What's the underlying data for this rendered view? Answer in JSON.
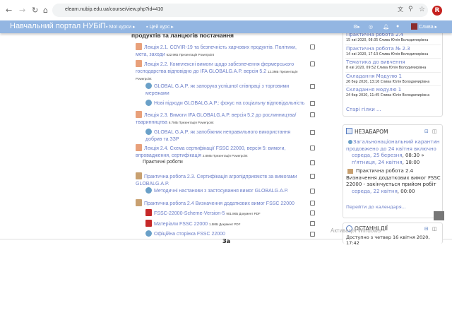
{
  "browser": {
    "url": "elearn.nubip.edu.ua/course/view.php?id=410",
    "profile_initial": "R"
  },
  "navbar": {
    "brand": "Навчальний портал НУБіП",
    "my_courses": "Мої курси ▸",
    "this_course": "Цей курс ▸",
    "user": "Слива ▸"
  },
  "main": {
    "section_title": "продуктів та ланцюгів постачання",
    "activities": [
      {
        "type": "ppt",
        "title": "Лекція 2.1. COVIR-19 та безпечність харчових продуктів. Політики, мета, заходи",
        "meta": "622.9КБ Презентація Powerpoint"
      },
      {
        "type": "ppt",
        "title": "Лекція 2.2. Комплексні вимоги щодо забезпечення фермерського господарства відповідно до IFA GLOBALG.A.P. версія 5.2",
        "meta": "12.3МБ Презентація Powerpoint"
      },
      {
        "type": "url",
        "title": "GLOBAL G.A.P. як запорука успішної співпраці з торговими мережами",
        "meta": ""
      },
      {
        "type": "url",
        "title": "Нові підходи GLOBALG.A.P.: фокус на соціальну відповідальність",
        "meta": ""
      },
      {
        "type": "ppt",
        "title": "Лекція 2.3. Вимоги IFA GLOBALG.A.P. версія 5.2 до рослинництва/тваринництва",
        "meta": "8.7МБ Презентація Powerpoint"
      },
      {
        "type": "url",
        "title": "GLOBAL G.A.P. як запобіжник неправильного використання добрив та ЗЗР",
        "meta": ""
      },
      {
        "type": "ppt",
        "title": "Лекція 2.4. Схема сертифікації FSSC 22000, версія 5: вимоги, впровадження, сертифікація",
        "meta": "2.8МБ Презентація Powerpoint"
      },
      {
        "type": "label",
        "title": "Практичні роботи",
        "meta": ""
      },
      {
        "type": "asg",
        "title": "Практична робота 2.3. Сертифікація агропідприємств за вимогами GLOBALG.A.P.",
        "meta": ""
      },
      {
        "type": "url",
        "title": "Методичні настанови з застосування вимог GLOBALG.A.P.",
        "meta": ""
      },
      {
        "type": "asg",
        "title": "Практична робота 2.4 Визначення додаткових вимог FSSC 22000",
        "meta": ""
      },
      {
        "type": "pdf",
        "title": "FSSC-22000-Scheme-Version-5",
        "meta": "901.8КБ Документ PDF"
      },
      {
        "type": "pdf",
        "title": "Матеріали FSSC 22000",
        "meta": "1.5МБ Документ PDF"
      },
      {
        "type": "url",
        "title": "Офіційна сторінка FSSC 22000",
        "meta": ""
      }
    ],
    "below_text": "За"
  },
  "forum": {
    "posts": [
      {
        "title": "Практична робота 2.4",
        "meta": "15 кві 2020, 08:35  Слива Юлія Володимирівна"
      },
      {
        "title": "Практична робота № 2.3",
        "meta": "14 кві 2020, 17:13  Слива Юлія Володимирівна"
      },
      {
        "title": "Тематика до вивчення",
        "meta": "8 кві 2020, 09:52  Слива Юлія Володимирівна"
      },
      {
        "title": "Складання Модулю 1",
        "meta": "26 бер 2020, 13:16  Слива Юлія Володимирівна"
      },
      {
        "title": "Складання модулю 1",
        "meta": "24 бер 2020, 11:45  Слива Юлія Володимирівна"
      }
    ],
    "older": "Старі гілки ..."
  },
  "upcoming": {
    "title": "НЕЗАБАРОМ",
    "e1_title": "Загальнонаціональний карантин продовжено до 24 квітня включно",
    "e1_date1": "середа, 25 березня",
    "e1_time1": ", 08:30 »",
    "e1_date2": "п'ятниця, 24 квітня",
    "e1_time2": ", 18:00",
    "e2_title": "Практична робота 2.4 Визначення додаткових вимог FSSC 22000 - закінчується прийом робіт",
    "e2_date": "середа, 22 квітня",
    "e2_time": ", 00:00",
    "calendar_link": "Перейти до календаря..."
  },
  "recent": {
    "title": "ОСТАННІ ДІЇ",
    "line": "Доступно з четвер 16 квітня 2020, 17:42"
  },
  "watermark": "Активація Windows",
  "colors": {
    "navbar": "#93b6e2",
    "link": "#6a7dc8"
  }
}
